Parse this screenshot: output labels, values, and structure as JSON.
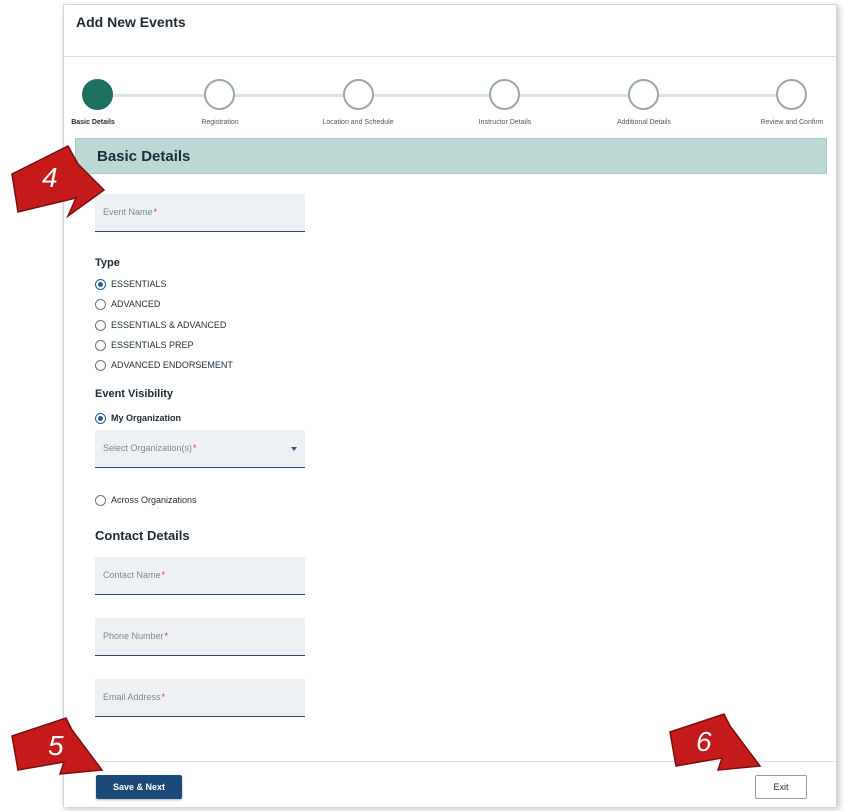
{
  "window": {
    "title": "Add New Events"
  },
  "stepper": {
    "steps": [
      {
        "label": "Basic Details",
        "active": true
      },
      {
        "label": "Registration",
        "active": false
      },
      {
        "label": "Location and Schedule",
        "active": false
      },
      {
        "label": "Instructor Details",
        "active": false
      },
      {
        "label": "Additional Details",
        "active": false
      },
      {
        "label": "Review and Confirm",
        "active": false
      }
    ],
    "active_color": "#1d6f5e"
  },
  "section": {
    "title": "Basic Details"
  },
  "event_name": {
    "placeholder": "Event Name",
    "required_mark": "*"
  },
  "type": {
    "label": "Type",
    "options": [
      "ESSENTIALS",
      "ADVANCED",
      "ESSENTIALS & ADVANCED",
      "ESSENTIALS PREP",
      "ADVANCED ENDORSEMENT"
    ],
    "selected": "ESSENTIALS"
  },
  "visibility": {
    "label": "Event Visibility",
    "my_org": "My Organization",
    "org_select_placeholder": "Select Organization(s)",
    "required_mark": "*",
    "across_orgs": "Across Organizations",
    "selected": "My Organization"
  },
  "contact": {
    "label": "Contact Details",
    "fields": [
      {
        "placeholder": "Contact Name",
        "required_mark": "*"
      },
      {
        "placeholder": "Phone Number",
        "required_mark": "*"
      },
      {
        "placeholder": "Email Address",
        "required_mark": "*"
      }
    ]
  },
  "footer": {
    "save_label": "Save & Next",
    "exit_label": "Exit"
  },
  "callouts": [
    "4",
    "5",
    "6"
  ],
  "colors": {
    "primary": "#1b4a78",
    "section_bg": "#bcd8d4",
    "callout": "#c41a1a"
  }
}
